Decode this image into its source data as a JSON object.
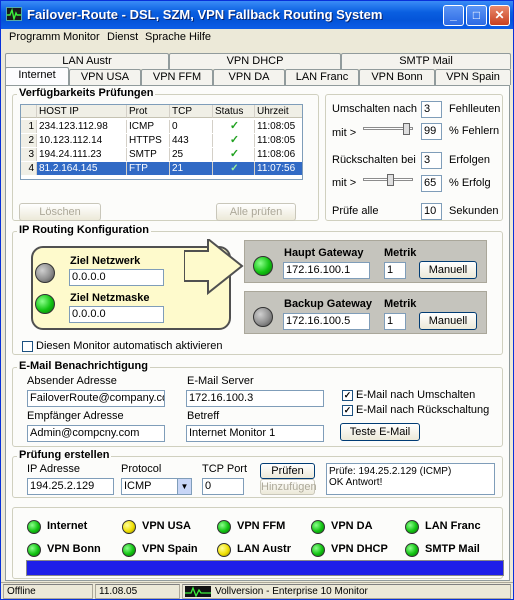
{
  "window": {
    "title": "Failover-Route - DSL, SZM, VPN Fallback Routing System"
  },
  "menu": [
    "Programm",
    "Monitor",
    "Dienst",
    "Sprache",
    "Hilfe"
  ],
  "tabs": {
    "row1": [
      "LAN Austr",
      "VPN DHCP",
      "SMTP Mail"
    ],
    "row2": [
      "Internet",
      "VPN USA",
      "VPN FFM",
      "VPN DA",
      "LAN Franc",
      "VPN Bonn",
      "VPN Spain"
    ]
  },
  "availability": {
    "title": "Verfügbarkeits Prüfungen",
    "headers": [
      "HOST IP",
      "Prot",
      "TCP",
      "Status",
      "Uhrzeit"
    ],
    "rows": [
      {
        "n": "1",
        "host": "234.123.112.98",
        "prot": "ICMP",
        "tcp": "0",
        "status": "✓",
        "time": "11:08:05"
      },
      {
        "n": "2",
        "host": "10.123.112.14",
        "prot": "HTTPS",
        "tcp": "443",
        "status": "✓",
        "time": "11:08:05"
      },
      {
        "n": "3",
        "host": "194.24.111.23",
        "prot": "SMTP",
        "tcp": "25",
        "status": "✓",
        "time": "11:08:06"
      },
      {
        "n": "4",
        "host": "81.2.164.145",
        "prot": "FTP",
        "tcp": "21",
        "status": "✓",
        "time": "11:07:56"
      }
    ],
    "delete_btn": "Löschen",
    "check_all_btn": "Alle prüfen"
  },
  "switching": {
    "switch_label": "Umschalten nach",
    "switch_value": "3",
    "errors_label": "Fehlleuten",
    "min_label": "mit >",
    "min_value": "99",
    "pct_error_label": "% Fehlern",
    "back_label": "Rückschalten bei",
    "back_value": "3",
    "success_label": "Erfolgen",
    "min2_label": "mit >",
    "min2_value": "65",
    "pct_success_label": "% Erfolg",
    "check_every_label": "Prüfe alle",
    "check_every_value": "10",
    "seconds_label": "Sekunden",
    "slider1_level": 0.92,
    "slider2_level": 0.55
  },
  "ip_routing": {
    "title": "IP Routing Konfiguration",
    "target_label": "Ziel Netzwerk",
    "target_value": "0.0.0.0",
    "mask_label": "Ziel Netzmaske",
    "mask_value": "0.0.0.0",
    "auto_monitor_label": "Diesen Monitor automatisch aktivieren",
    "main_gateway": {
      "title": "Haupt Gateway",
      "ip": "172.16.100.1",
      "metric_label": "Metrik",
      "metric": "1",
      "btn": "Manuell"
    },
    "backup_gateway": {
      "title": "Backup Gateway",
      "ip": "172.16.100.5",
      "metric_label": "Metrik",
      "metric": "1",
      "btn": "Manuell"
    }
  },
  "email": {
    "title": "E-Mail Benachrichtigung",
    "sender_label": "Absender Adresse",
    "sender_value": "FailoverRoute@company.com",
    "server_label": "E-Mail Server",
    "server_value": "172.16.100.3",
    "recipient_label": "Empfänger Adresse",
    "recipient_value": "Admin@compcny.com",
    "subject_label": "Betreff",
    "subject_value": "Internet Monitor 1",
    "notify_switch": "E-Mail nach Umschalten",
    "notify_back": "E-Mail nach Rückschaltung",
    "test_btn": "Teste E-Mail"
  },
  "test": {
    "title": "Prüfung erstellen",
    "ip_label": "IP Adresse",
    "ip_value": "194.25.2.129",
    "protocol_label": "Protocol",
    "protocol_value": "ICMP",
    "port_label": "TCP Port",
    "port_value": "0",
    "check_btn": "Prüfen",
    "add_btn": "Hinzufügen",
    "result_line1": "Prüfe: 194.25.2.129 (ICMP)",
    "result_line2": "OK Antwort!"
  },
  "status_monitors": [
    {
      "name": "Internet",
      "state": "green"
    },
    {
      "name": "VPN USA",
      "state": "yellow"
    },
    {
      "name": "VPN FFM",
      "state": "green"
    },
    {
      "name": "VPN DA",
      "state": "green"
    },
    {
      "name": "LAN Franc",
      "state": "green"
    },
    {
      "name": "VPN Bonn",
      "state": "green"
    },
    {
      "name": "VPN Spain",
      "state": "green"
    },
    {
      "name": "LAN Austr",
      "state": "yellow"
    },
    {
      "name": "VPN DHCP",
      "state": "green"
    },
    {
      "name": "SMTP Mail",
      "state": "green"
    }
  ],
  "progress": {
    "level": 1.0
  },
  "statusbar": {
    "state": "Offline",
    "time": "11.08.05",
    "version": "Vollversion - Enterprise 10 Monitor"
  },
  "colors": {
    "title_blue": "#0454d8",
    "progress_blue": "#1e1ee8",
    "led_green": "#11c311",
    "led_yellow": "#f0e000",
    "selected_row": "#316ac5"
  }
}
